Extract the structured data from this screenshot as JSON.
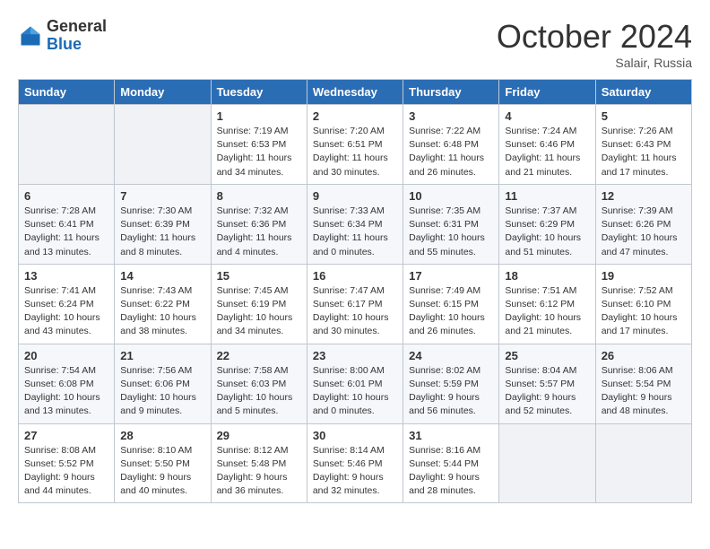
{
  "header": {
    "logo_line1": "General",
    "logo_line2": "Blue",
    "month": "October 2024",
    "location": "Salair, Russia"
  },
  "days_of_week": [
    "Sunday",
    "Monday",
    "Tuesday",
    "Wednesday",
    "Thursday",
    "Friday",
    "Saturday"
  ],
  "weeks": [
    [
      {
        "day": "",
        "detail": ""
      },
      {
        "day": "",
        "detail": ""
      },
      {
        "day": "1",
        "detail": "Sunrise: 7:19 AM\nSunset: 6:53 PM\nDaylight: 11 hours\nand 34 minutes."
      },
      {
        "day": "2",
        "detail": "Sunrise: 7:20 AM\nSunset: 6:51 PM\nDaylight: 11 hours\nand 30 minutes."
      },
      {
        "day": "3",
        "detail": "Sunrise: 7:22 AM\nSunset: 6:48 PM\nDaylight: 11 hours\nand 26 minutes."
      },
      {
        "day": "4",
        "detail": "Sunrise: 7:24 AM\nSunset: 6:46 PM\nDaylight: 11 hours\nand 21 minutes."
      },
      {
        "day": "5",
        "detail": "Sunrise: 7:26 AM\nSunset: 6:43 PM\nDaylight: 11 hours\nand 17 minutes."
      }
    ],
    [
      {
        "day": "6",
        "detail": "Sunrise: 7:28 AM\nSunset: 6:41 PM\nDaylight: 11 hours\nand 13 minutes."
      },
      {
        "day": "7",
        "detail": "Sunrise: 7:30 AM\nSunset: 6:39 PM\nDaylight: 11 hours\nand 8 minutes."
      },
      {
        "day": "8",
        "detail": "Sunrise: 7:32 AM\nSunset: 6:36 PM\nDaylight: 11 hours\nand 4 minutes."
      },
      {
        "day": "9",
        "detail": "Sunrise: 7:33 AM\nSunset: 6:34 PM\nDaylight: 11 hours\nand 0 minutes."
      },
      {
        "day": "10",
        "detail": "Sunrise: 7:35 AM\nSunset: 6:31 PM\nDaylight: 10 hours\nand 55 minutes."
      },
      {
        "day": "11",
        "detail": "Sunrise: 7:37 AM\nSunset: 6:29 PM\nDaylight: 10 hours\nand 51 minutes."
      },
      {
        "day": "12",
        "detail": "Sunrise: 7:39 AM\nSunset: 6:26 PM\nDaylight: 10 hours\nand 47 minutes."
      }
    ],
    [
      {
        "day": "13",
        "detail": "Sunrise: 7:41 AM\nSunset: 6:24 PM\nDaylight: 10 hours\nand 43 minutes."
      },
      {
        "day": "14",
        "detail": "Sunrise: 7:43 AM\nSunset: 6:22 PM\nDaylight: 10 hours\nand 38 minutes."
      },
      {
        "day": "15",
        "detail": "Sunrise: 7:45 AM\nSunset: 6:19 PM\nDaylight: 10 hours\nand 34 minutes."
      },
      {
        "day": "16",
        "detail": "Sunrise: 7:47 AM\nSunset: 6:17 PM\nDaylight: 10 hours\nand 30 minutes."
      },
      {
        "day": "17",
        "detail": "Sunrise: 7:49 AM\nSunset: 6:15 PM\nDaylight: 10 hours\nand 26 minutes."
      },
      {
        "day": "18",
        "detail": "Sunrise: 7:51 AM\nSunset: 6:12 PM\nDaylight: 10 hours\nand 21 minutes."
      },
      {
        "day": "19",
        "detail": "Sunrise: 7:52 AM\nSunset: 6:10 PM\nDaylight: 10 hours\nand 17 minutes."
      }
    ],
    [
      {
        "day": "20",
        "detail": "Sunrise: 7:54 AM\nSunset: 6:08 PM\nDaylight: 10 hours\nand 13 minutes."
      },
      {
        "day": "21",
        "detail": "Sunrise: 7:56 AM\nSunset: 6:06 PM\nDaylight: 10 hours\nand 9 minutes."
      },
      {
        "day": "22",
        "detail": "Sunrise: 7:58 AM\nSunset: 6:03 PM\nDaylight: 10 hours\nand 5 minutes."
      },
      {
        "day": "23",
        "detail": "Sunrise: 8:00 AM\nSunset: 6:01 PM\nDaylight: 10 hours\nand 0 minutes."
      },
      {
        "day": "24",
        "detail": "Sunrise: 8:02 AM\nSunset: 5:59 PM\nDaylight: 9 hours\nand 56 minutes."
      },
      {
        "day": "25",
        "detail": "Sunrise: 8:04 AM\nSunset: 5:57 PM\nDaylight: 9 hours\nand 52 minutes."
      },
      {
        "day": "26",
        "detail": "Sunrise: 8:06 AM\nSunset: 5:54 PM\nDaylight: 9 hours\nand 48 minutes."
      }
    ],
    [
      {
        "day": "27",
        "detail": "Sunrise: 8:08 AM\nSunset: 5:52 PM\nDaylight: 9 hours\nand 44 minutes."
      },
      {
        "day": "28",
        "detail": "Sunrise: 8:10 AM\nSunset: 5:50 PM\nDaylight: 9 hours\nand 40 minutes."
      },
      {
        "day": "29",
        "detail": "Sunrise: 8:12 AM\nSunset: 5:48 PM\nDaylight: 9 hours\nand 36 minutes."
      },
      {
        "day": "30",
        "detail": "Sunrise: 8:14 AM\nSunset: 5:46 PM\nDaylight: 9 hours\nand 32 minutes."
      },
      {
        "day": "31",
        "detail": "Sunrise: 8:16 AM\nSunset: 5:44 PM\nDaylight: 9 hours\nand 28 minutes."
      },
      {
        "day": "",
        "detail": ""
      },
      {
        "day": "",
        "detail": ""
      }
    ]
  ]
}
